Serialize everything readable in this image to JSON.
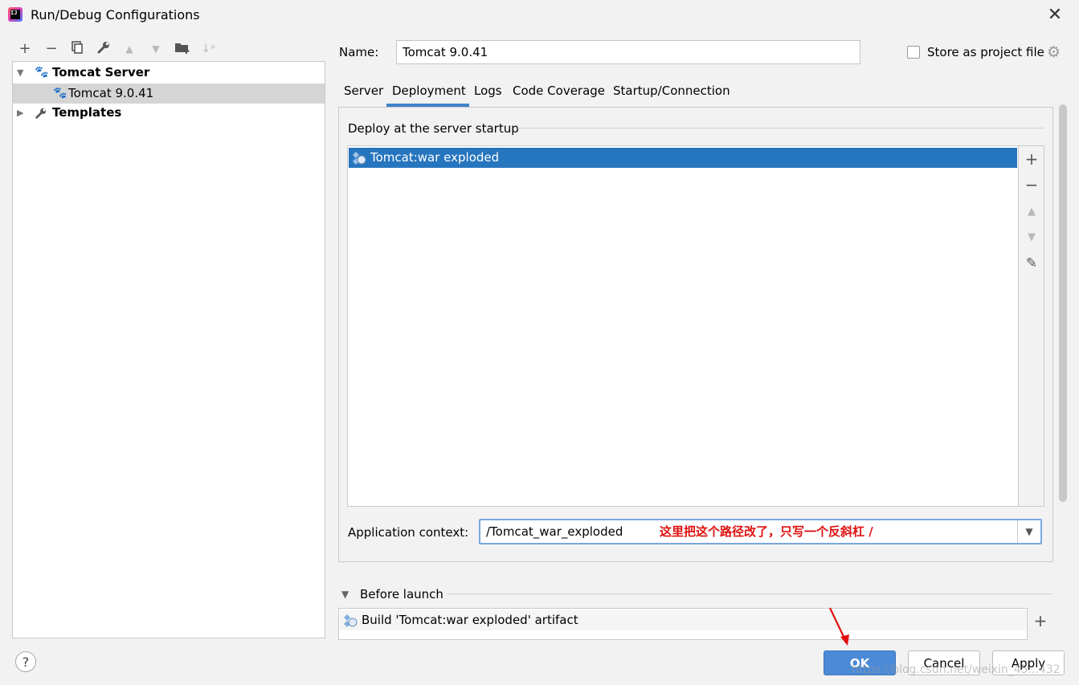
{
  "window": {
    "title": "Run/Debug Configurations",
    "app_icon": "intellij-icon",
    "close_icon": "close-icon"
  },
  "toolbar": {
    "icons": [
      "add-icon",
      "remove-icon",
      "copy-icon",
      "wrench-icon",
      "move-up-icon",
      "move-down-icon",
      "new-folder-icon",
      "sort-icon"
    ]
  },
  "tree": {
    "items": [
      {
        "label": "Tomcat Server",
        "expanded": true,
        "icon": "tomcat-icon"
      },
      {
        "label": "Tomcat 9.0.41",
        "selected": true,
        "icon": "tomcat-icon"
      },
      {
        "label": "Templates",
        "expanded": false,
        "icon": "wrench-icon"
      }
    ]
  },
  "config": {
    "name_label": "Name:",
    "name_value": "Tomcat 9.0.41",
    "store_label": "Store as project file",
    "store_checked": false
  },
  "tabs": [
    "Server",
    "Deployment",
    "Logs",
    "Code Coverage",
    "Startup/Connection"
  ],
  "active_tab": "Deployment",
  "deployment": {
    "section_title": "Deploy at the server startup",
    "artifacts": [
      "Tomcat:war exploded"
    ],
    "side_icons": [
      "add-icon",
      "remove-icon",
      "move-up-icon",
      "move-down-icon",
      "edit-icon"
    ],
    "context_label": "Application context:",
    "context_value": "/Tomcat_war_exploded",
    "annotation": "这里把这个路径改了，只写一个反斜杠 /"
  },
  "before_launch": {
    "title": "Before launch",
    "tasks": [
      "Build 'Tomcat:war exploded' artifact"
    ]
  },
  "buttons": {
    "ok": "OK",
    "cancel": "Cancel",
    "apply": "Apply",
    "help": "?"
  },
  "watermark": "https://blog.csdn.net/weixin_45...432",
  "colors": {
    "selection": "#2675bf",
    "tab_underline": "#4083c9",
    "ok_button": "#4a8ad7",
    "annotation": "#e01010"
  }
}
